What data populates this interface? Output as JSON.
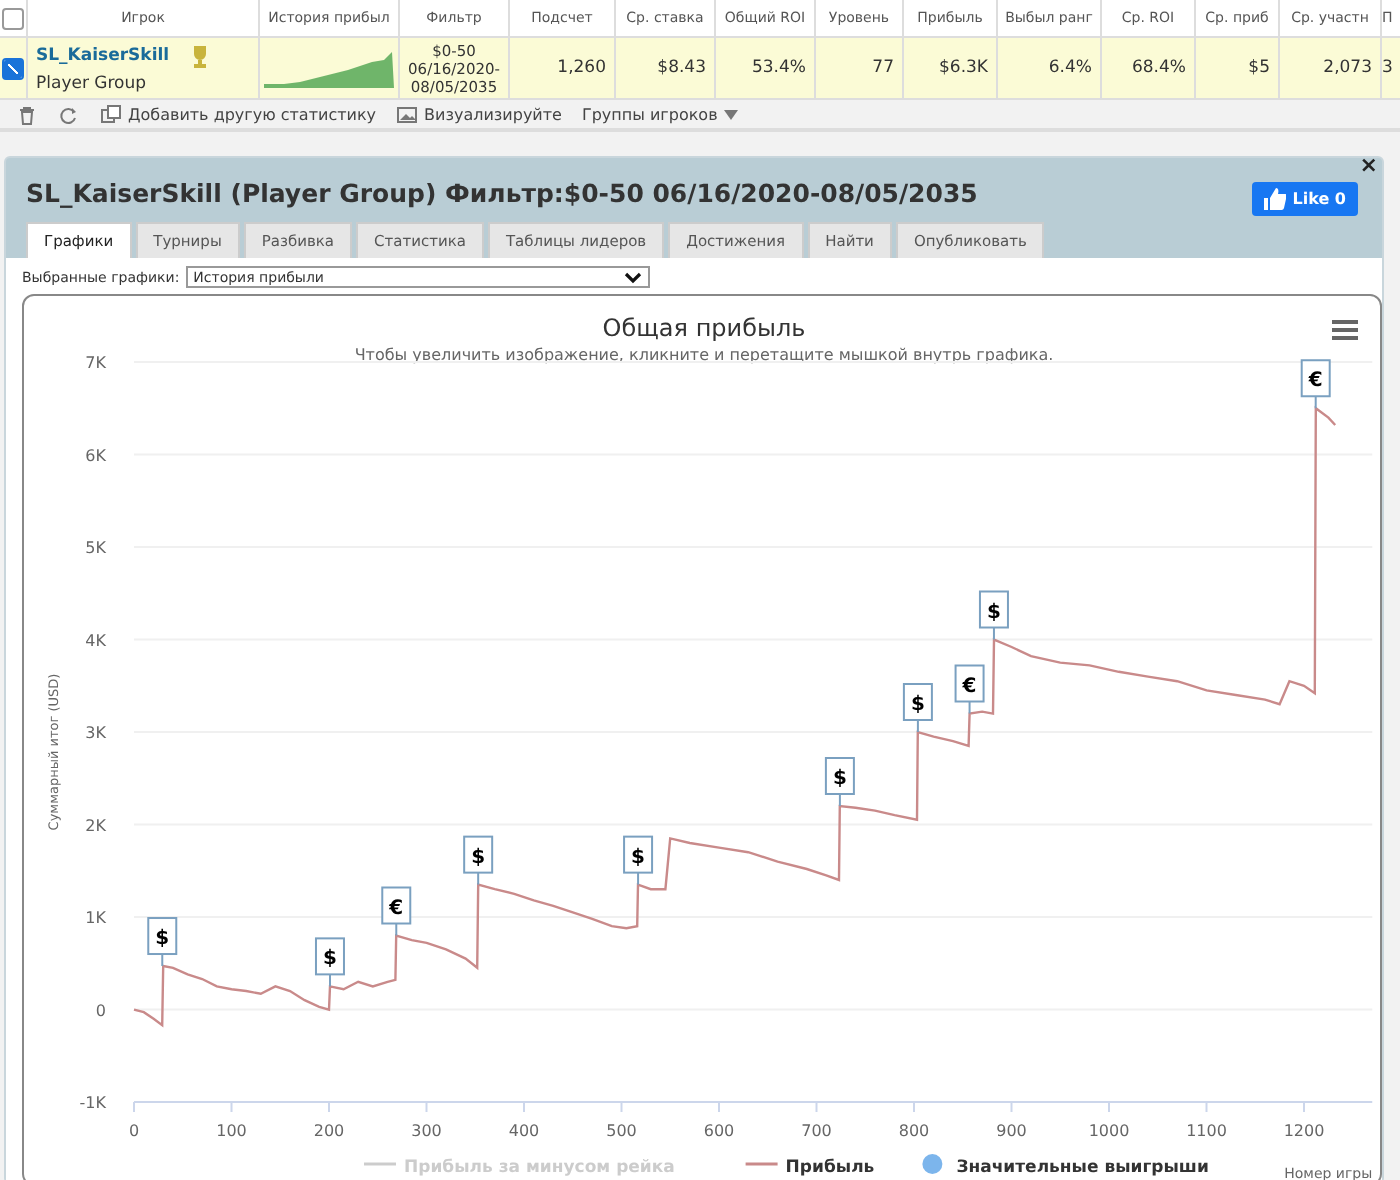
{
  "stats_table": {
    "select_all": {
      "checked": false
    },
    "columns": [
      {
        "label": "Игрок"
      },
      {
        "label": "История прибыл"
      },
      {
        "label": "Фильтр"
      },
      {
        "label": "Подсчет"
      },
      {
        "label": "Ср. ставка"
      },
      {
        "label": "Общий ROI"
      },
      {
        "label": "Уровень"
      },
      {
        "label": "Прибыль"
      },
      {
        "label": "Выбыл ранг"
      },
      {
        "label": "Ср. ROI"
      },
      {
        "label": "Ср. приб"
      },
      {
        "label": "Ср. участн"
      },
      {
        "label": "П"
      }
    ],
    "rows": [
      {
        "selected": true,
        "cells": [
          {
            "kind": "player",
            "text": "SL_KaiserSkill",
            "subtext": "Player Group"
          },
          {
            "kind": "sparkline"
          },
          {
            "kind": "filter",
            "text": "$0-50 06/16/2020-08/05/2035"
          },
          {
            "kind": "number",
            "text": "1,260"
          },
          {
            "kind": "number",
            "text": "$8.43"
          },
          {
            "kind": "number",
            "text": "53.4%"
          },
          {
            "kind": "number",
            "text": "77"
          },
          {
            "kind": "number",
            "text": "$6.3K"
          },
          {
            "kind": "number",
            "text": "6.4%"
          },
          {
            "kind": "number",
            "text": "68.4%"
          },
          {
            "kind": "number",
            "text": "$5"
          },
          {
            "kind": "number",
            "text": "2,073"
          },
          {
            "kind": "number",
            "text": "3"
          }
        ]
      }
    ]
  },
  "toolbar": {
    "items": [
      {
        "kind": "delete"
      },
      {
        "kind": "refresh"
      },
      {
        "kind": "add",
        "label": "Добавить другую статистику"
      },
      {
        "kind": "visualize",
        "label": "Визуализируйте"
      },
      {
        "kind": "menu",
        "label": "Группы игроков"
      }
    ]
  },
  "panel": {
    "title": "SL_KaiserSkill (Player Group) Фильтр:$0-50 06/16/2020-08/05/2035",
    "like_button": "Like 0",
    "close": "×",
    "tabs": [
      {
        "label": "Графики",
        "selected": true
      },
      {
        "label": "Турниры",
        "selected": false
      },
      {
        "label": "Разбивка",
        "selected": false
      },
      {
        "label": "Статистика",
        "selected": false
      },
      {
        "label": "Таблицы лидеров",
        "selected": false
      },
      {
        "label": "Достижения",
        "selected": false
      },
      {
        "label": "Найти",
        "selected": false
      },
      {
        "label": "Опубликовать",
        "selected": false
      }
    ],
    "chart_select": {
      "label": "Выбранные графики:",
      "value": "История прибыли"
    },
    "chart": {
      "subtitle": "Чтобы увеличить изображение, кликните и перетащите мышкой внутрь графика.",
      "legend": [
        {
          "label": "Прибыль за минусом рейка",
          "kind": "line",
          "hidden": true,
          "color": "#cccccc"
        },
        {
          "kind": "series",
          "hidden": false
        },
        {
          "label": "Значительные выигрыши",
          "kind": "dot",
          "hidden": false,
          "color": "#7cb5ec"
        }
      ],
      "chart_data": {
        "type": "line",
        "title": "Общая прибыль",
        "xlabel": "Номер игры",
        "ylabel": "Суммарный итог (USD)",
        "xlim": [
          0,
          1270
        ],
        "ylim": [
          -1000,
          7000
        ],
        "grid": true,
        "xticks": [
          0,
          100,
          200,
          300,
          400,
          500,
          600,
          700,
          800,
          900,
          1000,
          1100,
          1200
        ],
        "yticks": [
          {
            "value": -1000,
            "label": "-1K"
          },
          {
            "value": 0,
            "label": "0"
          },
          {
            "value": 1000,
            "label": "1K"
          },
          {
            "value": 2000,
            "label": "2K"
          },
          {
            "value": 3000,
            "label": "3K"
          },
          {
            "value": 4000,
            "label": "4K"
          },
          {
            "value": 5000,
            "label": "5K"
          },
          {
            "value": 6000,
            "label": "6K"
          },
          {
            "value": 7000,
            "label": "7K"
          }
        ],
        "x": [
          0,
          10,
          20,
          29,
          30,
          40,
          55,
          70,
          85,
          100,
          115,
          130,
          145,
          160,
          175,
          190,
          200,
          201,
          215,
          230,
          245,
          260,
          268,
          269,
          285,
          300,
          320,
          340,
          352,
          353,
          370,
          390,
          410,
          430,
          450,
          470,
          490,
          505,
          516,
          517,
          530,
          545,
          550,
          570,
          600,
          630,
          660,
          690,
          710,
          723,
          724,
          740,
          760,
          780,
          803,
          804,
          820,
          840,
          856,
          857,
          870,
          881,
          882,
          900,
          920,
          950,
          980,
          1010,
          1040,
          1070,
          1100,
          1130,
          1160,
          1175,
          1185,
          1200,
          1211,
          1212,
          1225,
          1232
        ],
        "series": [
          {
            "name": "Прибыль",
            "color": "#c98a8a",
            "values": [
              0,
              -30,
              -100,
              -170,
              470,
              450,
              380,
              330,
              250,
              220,
              200,
              170,
              250,
              200,
              100,
              30,
              0,
              250,
              220,
              300,
              250,
              300,
              320,
              800,
              750,
              720,
              650,
              550,
              450,
              1350,
              1300,
              1250,
              1180,
              1120,
              1050,
              980,
              900,
              880,
              900,
              1350,
              1300,
              1300,
              1850,
              1800,
              1750,
              1700,
              1600,
              1520,
              1450,
              1400,
              2200,
              2180,
              2150,
              2100,
              2050,
              3000,
              2950,
              2900,
              2850,
              3200,
              3220,
              3200,
              4000,
              3920,
              3820,
              3750,
              3720,
              3650,
              3600,
              3550,
              3450,
              3400,
              3350,
              3300,
              3550,
              3500,
              3420,
              6500,
              6400,
              6320
            ]
          }
        ],
        "annotations": [
          {
            "x": 29,
            "y": 470,
            "text": "$"
          },
          {
            "x": 201,
            "y": 250,
            "text": "$"
          },
          {
            "x": 269,
            "y": 800,
            "text": "€"
          },
          {
            "x": 353,
            "y": 1350,
            "text": "$"
          },
          {
            "x": 517,
            "y": 1350,
            "text": "$"
          },
          {
            "x": 724,
            "y": 2200,
            "text": "$"
          },
          {
            "x": 804,
            "y": 3000,
            "text": "$"
          },
          {
            "x": 857,
            "y": 3200,
            "text": "€"
          },
          {
            "x": 882,
            "y": 4000,
            "text": "$"
          },
          {
            "x": 1212,
            "y": 6500,
            "text": "€"
          }
        ]
      }
    }
  }
}
